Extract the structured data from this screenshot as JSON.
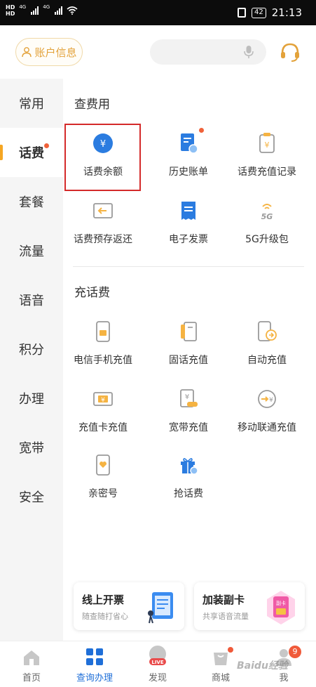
{
  "status_bar": {
    "sim1": "HD",
    "sim2": "HD",
    "net1": "4G",
    "net2": "4G",
    "battery": "42",
    "time": "21:13"
  },
  "header": {
    "account_label": "账户信息",
    "accent_color": "#e3a23a"
  },
  "sidebar": {
    "items": [
      {
        "label": "常用"
      },
      {
        "label": "话费"
      },
      {
        "label": "套餐"
      },
      {
        "label": "流量"
      },
      {
        "label": "语音"
      },
      {
        "label": "积分"
      },
      {
        "label": "办理"
      },
      {
        "label": "宽带"
      },
      {
        "label": "安全"
      }
    ],
    "active": "话费"
  },
  "sections": {
    "query": {
      "title": "查费用",
      "items": [
        {
          "label": "话费余额",
          "icon": "yuan-circle-icon"
        },
        {
          "label": "历史账单",
          "icon": "bill-history-icon"
        },
        {
          "label": "话费充值记录",
          "icon": "recharge-record-icon"
        },
        {
          "label": "话费预存返还",
          "icon": "prepay-return-icon"
        },
        {
          "label": "电子发票",
          "icon": "invoice-icon"
        },
        {
          "label": "5G升级包",
          "icon": "5g-package-icon",
          "icon_text": "5G"
        }
      ]
    },
    "recharge": {
      "title": "充话费",
      "items": [
        {
          "label": "电信手机充值",
          "icon": "phone-recharge-icon"
        },
        {
          "label": "固话充值",
          "icon": "landline-icon"
        },
        {
          "label": "自动充值",
          "icon": "auto-recharge-icon"
        },
        {
          "label": "充值卡充值",
          "icon": "card-recharge-icon"
        },
        {
          "label": "宽带充值",
          "icon": "broadband-recharge-icon"
        },
        {
          "label": "移动联通充值",
          "icon": "other-carrier-icon"
        },
        {
          "label": "亲密号",
          "icon": "intimate-number-icon"
        },
        {
          "label": "抢话费",
          "icon": "gift-icon"
        }
      ]
    }
  },
  "promos": [
    {
      "title": "线上开票",
      "subtitle": "随查随打省心"
    },
    {
      "title": "加装副卡",
      "subtitle": "共享语音流量",
      "badge_text": "副卡"
    }
  ],
  "bottom_nav": {
    "items": [
      {
        "label": "首页",
        "icon": "home-icon"
      },
      {
        "label": "查询办理",
        "icon": "grid-icon"
      },
      {
        "label": "发现",
        "icon": "live-icon",
        "badge_text": "LIVE"
      },
      {
        "label": "商城",
        "icon": "shop-icon"
      },
      {
        "label": "我",
        "icon": "user-icon"
      }
    ],
    "active": "查询办理",
    "me_badge": "9"
  },
  "watermark": "Baidu经验"
}
